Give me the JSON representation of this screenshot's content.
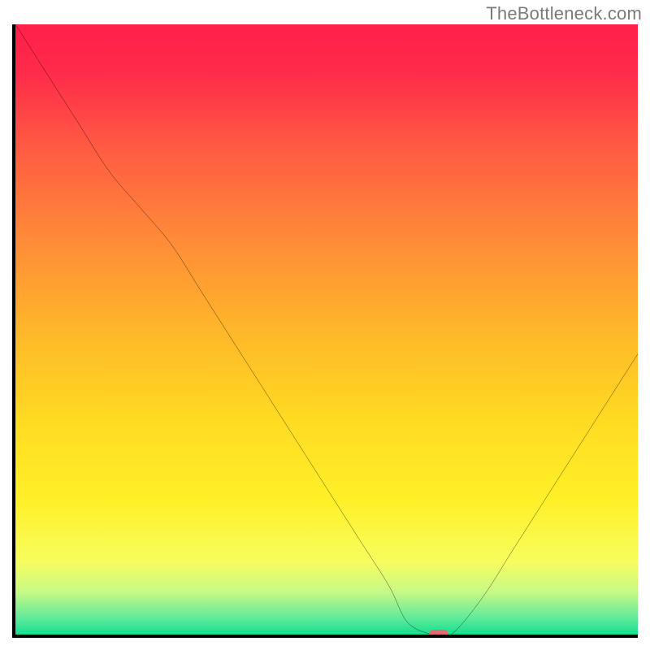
{
  "attribution": "TheBottleneck.com",
  "chart_data": {
    "type": "line",
    "title": "",
    "xlabel": "",
    "ylabel": "",
    "xlim": [
      0,
      100
    ],
    "ylim": [
      0,
      100
    ],
    "x": [
      0,
      5,
      10,
      15,
      20,
      25,
      30,
      35,
      40,
      45,
      50,
      55,
      60,
      63,
      67,
      70,
      75,
      80,
      85,
      90,
      95,
      100
    ],
    "values": [
      100,
      92,
      84,
      76,
      70,
      64,
      56,
      48,
      40,
      32,
      24,
      16,
      8,
      2,
      0,
      0,
      6,
      14,
      22,
      30,
      38,
      46
    ],
    "marker": {
      "x": 68,
      "y": 0
    },
    "background_gradient": {
      "stops": [
        {
          "pos": 0.0,
          "color": "#ff1f4b"
        },
        {
          "pos": 0.08,
          "color": "#ff2b4a"
        },
        {
          "pos": 0.2,
          "color": "#ff5a43"
        },
        {
          "pos": 0.35,
          "color": "#ff8a38"
        },
        {
          "pos": 0.5,
          "color": "#ffb62a"
        },
        {
          "pos": 0.65,
          "color": "#ffdb22"
        },
        {
          "pos": 0.78,
          "color": "#fff028"
        },
        {
          "pos": 0.88,
          "color": "#f7fd5e"
        },
        {
          "pos": 0.93,
          "color": "#c7f987"
        },
        {
          "pos": 0.975,
          "color": "#5be99a"
        },
        {
          "pos": 1.0,
          "color": "#12e08f"
        }
      ]
    }
  }
}
